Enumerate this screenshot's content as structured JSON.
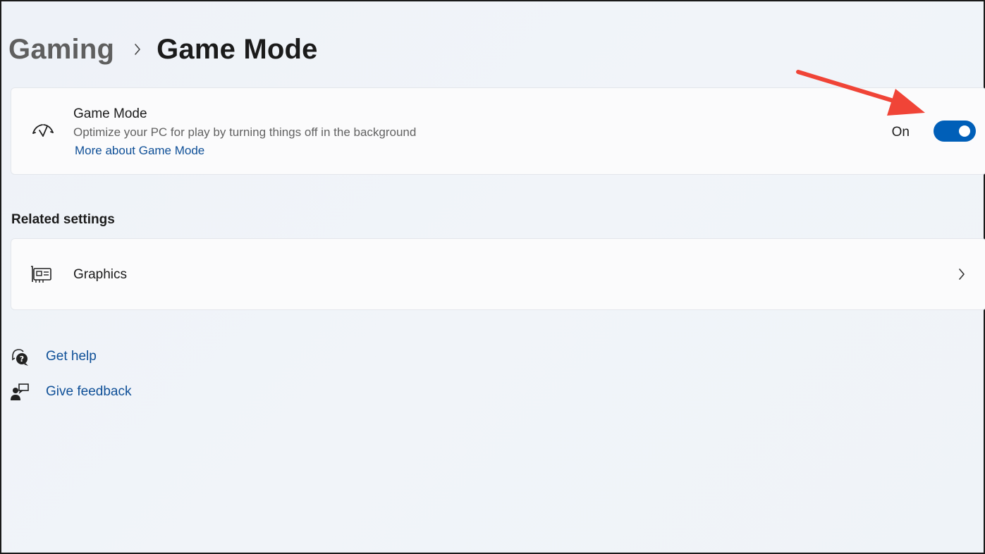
{
  "breadcrumb": {
    "parent": "Gaming",
    "current": "Game Mode"
  },
  "game_mode": {
    "title": "Game Mode",
    "description": "Optimize your PC for play by turning things off in the background",
    "link": "More about Game Mode",
    "toggle_state_label": "On",
    "toggle_on": true,
    "icon": "game-mode-gauge-icon"
  },
  "related": {
    "header": "Related settings",
    "items": [
      {
        "label": "Graphics",
        "icon": "graphics-card-icon"
      }
    ]
  },
  "help_links": [
    {
      "label": "Get help",
      "icon": "get-help-icon"
    },
    {
      "label": "Give feedback",
      "icon": "give-feedback-icon"
    }
  ],
  "colors": {
    "accent": "#005fb8",
    "link": "#0e4f97",
    "annotation_arrow": "#f04437"
  }
}
